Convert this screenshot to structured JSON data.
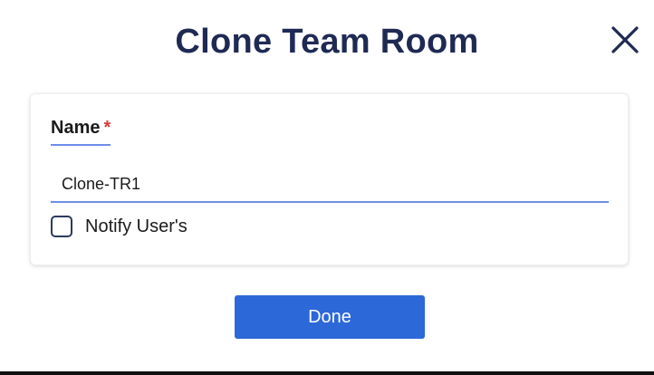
{
  "dialog": {
    "title": "Clone Team Room",
    "close_icon": "close-icon"
  },
  "form": {
    "name_label": "Name",
    "required_marker": "*",
    "name_value": "Clone-TR1",
    "notify_label": "Notify User's",
    "notify_checked": false
  },
  "actions": {
    "done_label": "Done"
  },
  "colors": {
    "title": "#1f2a54",
    "accent_underline": "#6e8ee8",
    "required": "#d63c3c",
    "primary_button": "#2d68d8"
  }
}
